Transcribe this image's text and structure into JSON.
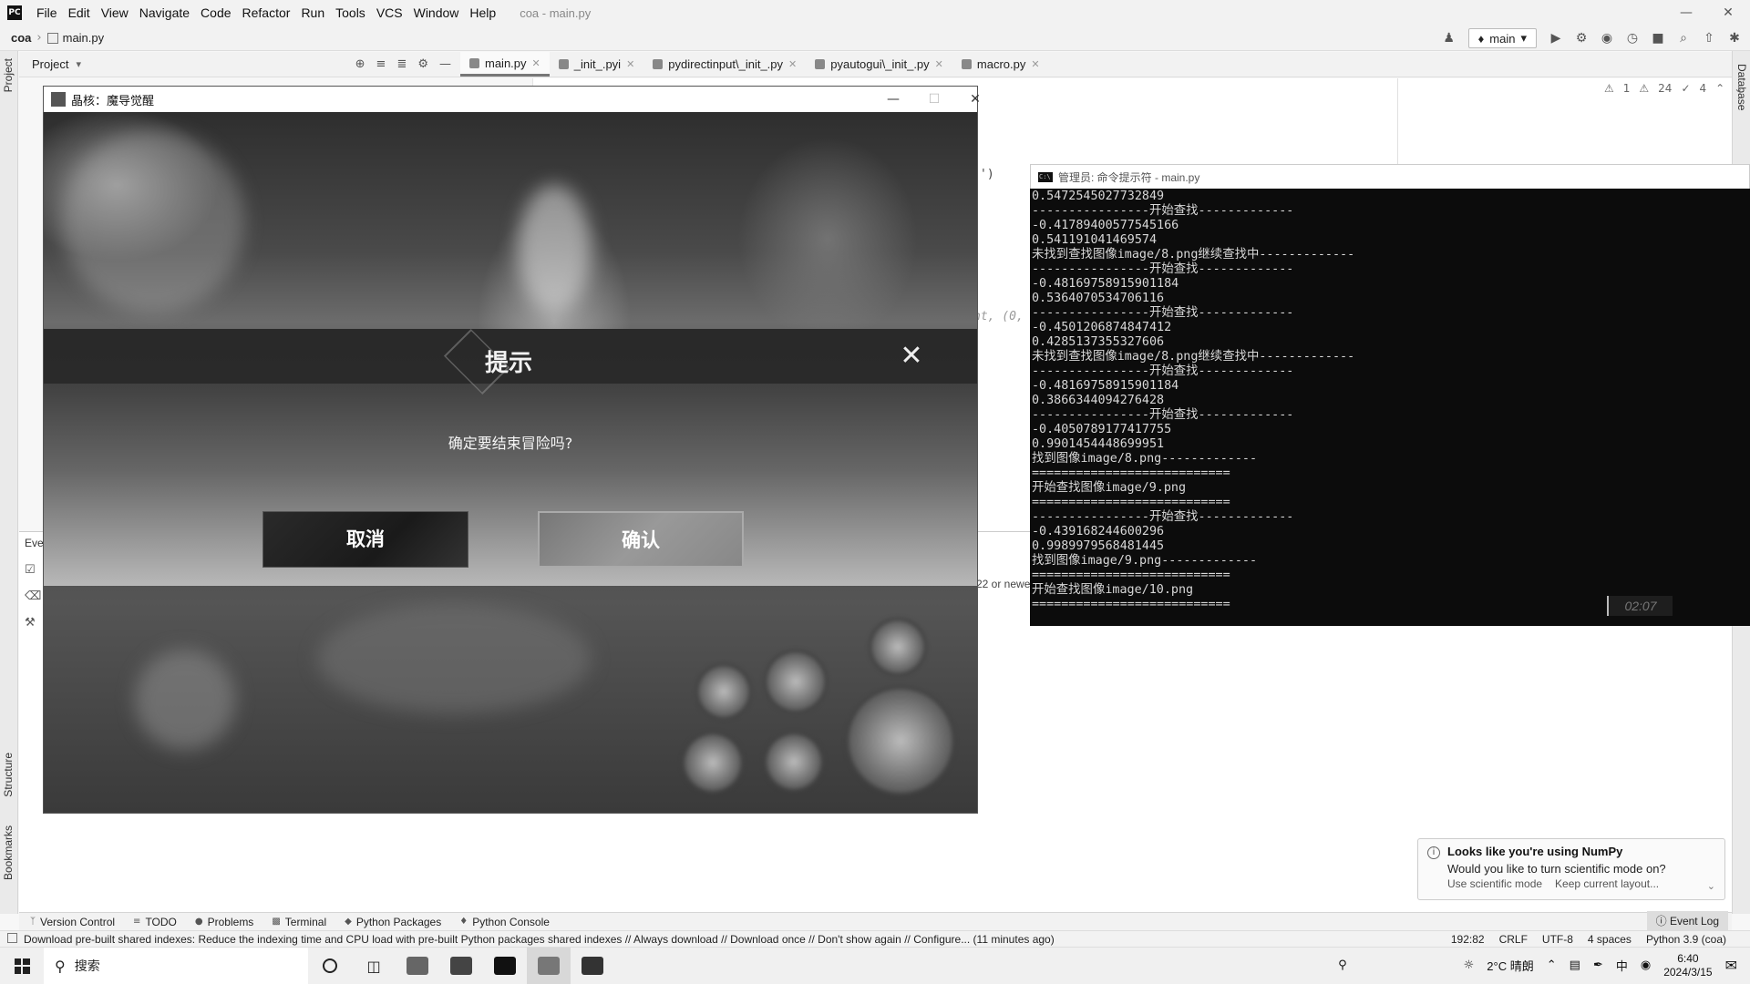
{
  "ide": {
    "title": "coa - main.py",
    "menu": [
      "File",
      "Edit",
      "View",
      "Navigate",
      "Code",
      "Refactor",
      "Run",
      "Tools",
      "VCS",
      "Window",
      "Help"
    ],
    "breadcrumb_root": "coa",
    "breadcrumb_file": "main.py",
    "run_config": "main",
    "project_panel_title": "Project",
    "tabs": [
      "main.py",
      "_init_.pyi",
      "pydirectinput\\_init_.py",
      "pyautogui\\_init_.py",
      "macro.py"
    ],
    "inspections": {
      "warnings": "1",
      "weak_warnings": "24",
      "typos": "4"
    },
    "code_fragments": {
      "paren": "')",
      "call": "nt, (0,"
    },
    "left_vertical_tabs": {
      "project": "Project",
      "structure": "Structure",
      "bookmarks": "Bookmarks"
    },
    "right_vertical_tabs": {
      "database": "Database"
    },
    "event_panel_label": "Eve",
    "event_fragment": "22 or newe",
    "tool_tabs": [
      "Version Control",
      "TODO",
      "Problems",
      "Terminal",
      "Python Packages",
      "Python Console"
    ],
    "event_log": "Event Log",
    "status_message": "Download pre-built shared indexes: Reduce the indexing time and CPU load with pre-built Python packages shared indexes // Always download // Download once // Don't show again // Configure... (11 minutes ago)",
    "status_right": {
      "position": "192:82",
      "line_sep": "CRLF",
      "encoding": "UTF-8",
      "indent": "4 spaces",
      "interpreter": "Python 3.9 (coa)"
    }
  },
  "notification": {
    "title": "Looks like you're using NumPy",
    "body": "Would you like to turn scientific mode on?",
    "action_primary": "Use scientific mode",
    "action_secondary": "Keep current layout..."
  },
  "terminal": {
    "title": "管理员: 命令提示符 - main.py",
    "lines": [
      "0.5472545027732849",
      "----------------开始查找-------------",
      "-0.41789400577545166",
      "0.541191041469574",
      "未找到查找图像image/8.png继续查找中-------------",
      "----------------开始查找-------------",
      "-0.48169758915901184",
      "0.5364070534706116",
      "----------------开始查找-------------",
      "-0.4501206874847412",
      "0.4285137355327606",
      "未找到查找图像image/8.png继续查找中-------------",
      "----------------开始查找-------------",
      "-0.48169758915901184",
      "0.3866344094276428",
      "----------------开始查找-------------",
      "-0.4050789177417755",
      "0.9901454448699951",
      "找到图像image/8.png-------------",
      "===========================",
      "开始查找图像image/9.png",
      "===========================",
      "----------------开始查找-------------",
      "-0.439168244600296",
      "0.9989979568481445",
      "找到图像image/9.png-------------",
      "===========================",
      "开始查找图像image/10.png",
      "==========================="
    ],
    "timer": "02:07"
  },
  "game": {
    "window_title": "晶核：魔导觉醒",
    "dialog_title": "提示",
    "dialog_message": "确定要结束冒险吗?",
    "cancel_label": "取消",
    "confirm_label": "确认"
  },
  "taskbar": {
    "search_placeholder": "搜索",
    "weather": "2°C  晴朗",
    "ime": "中",
    "time": "6:40",
    "date": "2024/3/15"
  }
}
